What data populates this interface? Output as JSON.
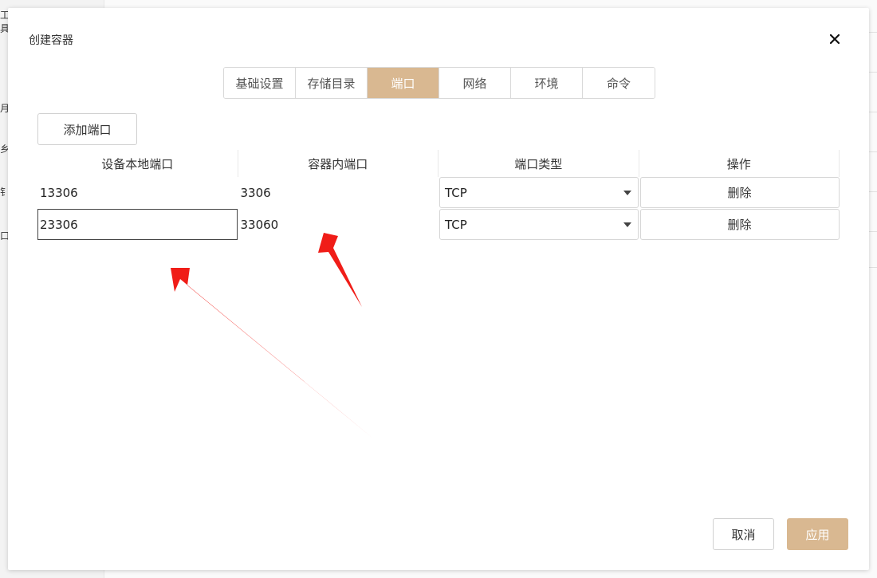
{
  "background": {
    "left_glyphs": [
      "工具",
      "月",
      "乡",
      "钅",
      "口"
    ]
  },
  "dialog": {
    "title": "创建容器",
    "close_icon": "close-icon"
  },
  "tabs": [
    {
      "label": "基础设置",
      "active": false
    },
    {
      "label": "存储目录",
      "active": false
    },
    {
      "label": "端口",
      "active": true
    },
    {
      "label": "网络",
      "active": false
    },
    {
      "label": "环境",
      "active": false
    },
    {
      "label": "命令",
      "active": false
    }
  ],
  "add_port_label": "添加端口",
  "table": {
    "headers": [
      "设备本地端口",
      "容器内端口",
      "端口类型",
      "操作"
    ],
    "rows": [
      {
        "local_port": "13306",
        "container_port": "3306",
        "type": "TCP",
        "action": "删除"
      },
      {
        "local_port": "23306",
        "container_port": "33060",
        "type": "TCP",
        "action": "删除"
      }
    ]
  },
  "footer": {
    "cancel_label": "取消",
    "apply_label": "应用"
  },
  "colors": {
    "accent": "#d9b891",
    "annotation_arrow": "#f01d18"
  }
}
